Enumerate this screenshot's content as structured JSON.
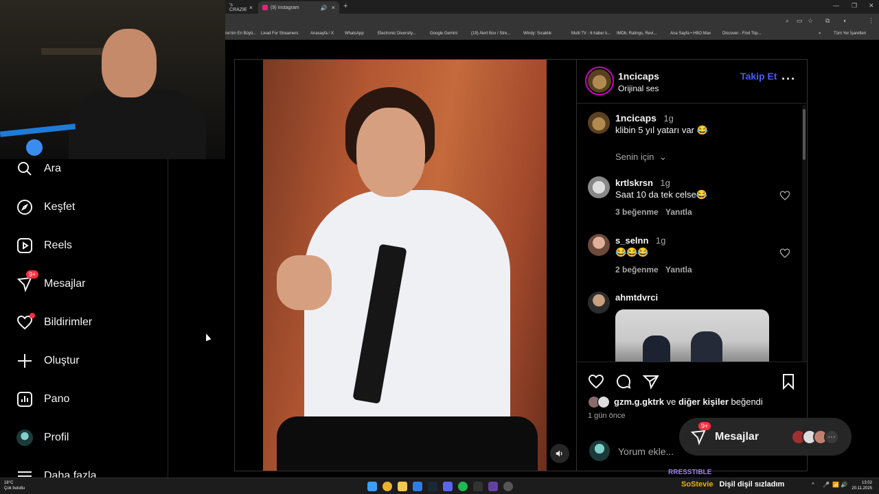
{
  "browser": {
    "tabs": [
      {
        "label": "'s CRAZIE",
        "active": false
      },
      {
        "label": "(9) Instagram",
        "active": true
      }
    ],
    "bookmarks": [
      "ne'nin En Büyü...",
      "Livad For Streamers",
      "Anasayfa / X",
      "WhatsApp",
      "Electronic Diversity...",
      "Google Gemini",
      "(19) Alert Box / Stre...",
      "Windy: Sıcaklık",
      "Multi TV - 6 haber k...",
      "IMDb: Ratings, Revi...",
      "Ana Sayfa • HBO Max",
      "Discover - Find Top...",
      "Tüm Yer İşaretleri"
    ]
  },
  "sidebar": {
    "items": [
      {
        "label": "Ara",
        "icon": "search-icon"
      },
      {
        "label": "Keşfet",
        "icon": "compass-icon"
      },
      {
        "label": "Reels",
        "icon": "reels-icon"
      },
      {
        "label": "Mesajlar",
        "icon": "messenger-icon",
        "badge": "9+"
      },
      {
        "label": "Bildirimler",
        "icon": "heart-icon"
      },
      {
        "label": "Oluştur",
        "icon": "plus-icon"
      },
      {
        "label": "Pano",
        "icon": "dashboard-icon"
      },
      {
        "label": "Profil",
        "icon": "profile-avatar"
      },
      {
        "label": "Daha fazla",
        "icon": "menu-icon"
      }
    ]
  },
  "post": {
    "username": "1ncicaps",
    "audio": "Orijinal ses",
    "follow_label": "Takip Et",
    "caption": {
      "user": "1ncicaps",
      "time": "1g",
      "text": "klibin 5 yıl yatarı var 😂"
    },
    "sort_label": "Senin için",
    "comments": [
      {
        "user": "krtlskrsn",
        "time": "1g",
        "text": "Saat 10 da tek celse😂",
        "likes": "3 beğenme",
        "reply": "Yanıtla"
      },
      {
        "user": "s_selnn",
        "time": "1g",
        "text": "😂😂😂",
        "likes": "2 beğenme",
        "reply": "Yanıtla"
      },
      {
        "user": "ahmtdvrci",
        "time": "",
        "text": "",
        "likes": "",
        "reply": ""
      }
    ],
    "liked_by": {
      "user": "gzm.g.gktrk",
      "mid": " ve ",
      "others": "diğer kişiler",
      "suffix": " beğendi"
    },
    "date": "1 gün önce",
    "comment_placeholder": "Yorum ekle..."
  },
  "messages_pill": {
    "label": "Mesajlar",
    "badge": "9+"
  },
  "overlay": {
    "streamer_tag": "RRESSTIBLE",
    "chat_user": "SoStevie",
    "chat_msg": "Dişil dişil sızladım"
  },
  "taskbar": {
    "weather_temp": "18°C",
    "weather_desc": "Çok bulutlu",
    "time": "13:02",
    "date": "20.11.2025"
  }
}
